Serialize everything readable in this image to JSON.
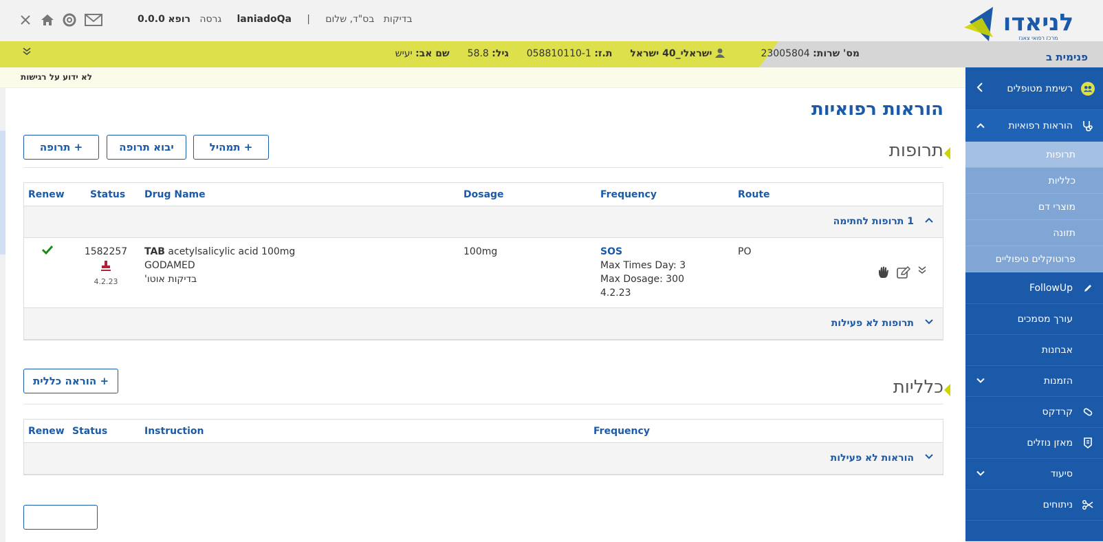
{
  "header": {
    "version_label": "0.0.0",
    "version_word": "גרסה",
    "role": "רופא",
    "username": "laniadoQa",
    "greeting": "בס\"ד, שלום",
    "env": "בדיקות",
    "separator": "|"
  },
  "logo": {
    "name": "לניאדו",
    "tagline": "מרכז רפואי צאנז"
  },
  "patient_bar": {
    "ward": "פנימית ב",
    "visit_label": "מס' שרות:",
    "visit_number": "23005804",
    "patient_name": "ישראלי_40 ישראל",
    "id_label": "ת.ז:",
    "id_value": "058810110-1",
    "age_label": "גיל:",
    "age_value": "58.8",
    "father_label": "שם אב:",
    "father_value": "יעיש"
  },
  "allergy": {
    "text": "לא ידוע על רגישות"
  },
  "sidebar": {
    "patients_list": "רשימת מטופלים",
    "medical_orders": "הוראות רפואיות",
    "sub_items": [
      "תרופות",
      "כלליות",
      "מוצרי דם",
      "תזונה",
      "פרוטוקלים טיפוליים"
    ],
    "followup": "FollowUp",
    "doc_editor": "עורך מסמכים",
    "diagnoses": "אבחנות",
    "appointments": "הזמנות",
    "cardex": "קרדקס",
    "fluid_balance": "מאזן נוזלים",
    "nursing": "סיעוד",
    "surgeries": "ניתוחים"
  },
  "main": {
    "page_title": "הוראות רפואיות",
    "meds_section": {
      "title": "תרופות",
      "buttons": {
        "add_drug": "+ תרופה",
        "import_drug": "יבוא תרופה",
        "add_solution": "+ תמהיל"
      },
      "columns": [
        "Renew",
        "Status",
        "Drug Name",
        "Dosage",
        "Frequency",
        "Route"
      ],
      "pending_group": "1 תרופות לחתימה",
      "inactive_group": "תרופות לא פעילות",
      "rows": [
        {
          "status_id": "1582257",
          "status_date": "4.2.23",
          "form": "TAB",
          "drug": "acetylsalicylic acid 100mg",
          "manufacturer": "GODAMED",
          "note": "בדיקות אוטו'",
          "dosage": "100mg",
          "frequency": "SOS",
          "max_times": "Max Times Day: 3",
          "max_dosage": "Max Dosage: 300",
          "freq_date": "4.2.23",
          "route": "PO"
        }
      ]
    },
    "general_section": {
      "title": "כלליות",
      "buttons": {
        "add_general": "+ הוראה כללית"
      },
      "columns": [
        "Renew",
        "Status",
        "Instruction",
        "Frequency"
      ],
      "inactive_group": "הוראות לא פעילות"
    }
  }
}
